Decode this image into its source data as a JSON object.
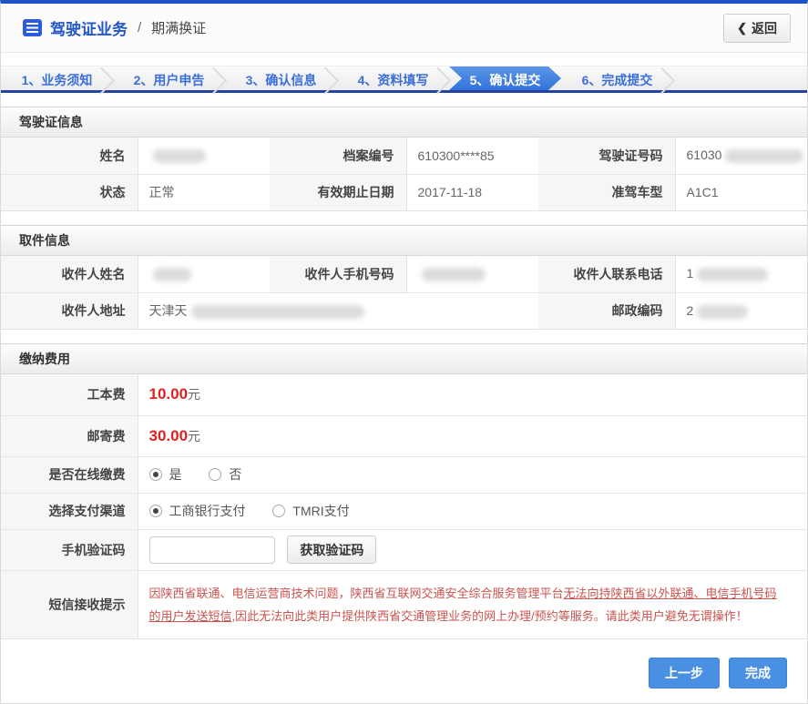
{
  "header": {
    "breadcrumb_section": "驾驶证业务",
    "breadcrumb_separator": "/",
    "breadcrumb_current": "期满换证",
    "back_chevron": "❮",
    "back_label": "返回"
  },
  "steps": [
    {
      "label": "1、业务须知",
      "active": false
    },
    {
      "label": "2、用户申告",
      "active": false
    },
    {
      "label": "3、确认信息",
      "active": false
    },
    {
      "label": "4、资料填写",
      "active": false
    },
    {
      "label": "5、确认提交",
      "active": true
    },
    {
      "label": "6、完成提交",
      "active": false
    }
  ],
  "license_section": {
    "title": "驾驶证信息",
    "fields": [
      {
        "label": "姓名",
        "value": "",
        "redacted": true
      },
      {
        "label": "档案编号",
        "value": "610300****85",
        "redacted": false
      },
      {
        "label": "驾驶证号码",
        "value": "61030",
        "redacted": true
      },
      {
        "label": "状态",
        "value": "正常",
        "redacted": false
      },
      {
        "label": "有效期止日期",
        "value": "2017-11-18",
        "redacted": false
      },
      {
        "label": "准驾车型",
        "value": "A1C1",
        "redacted": false
      }
    ]
  },
  "pickup_section": {
    "title": "取件信息",
    "fields": [
      {
        "label": "收件人姓名",
        "value": "",
        "redacted": true
      },
      {
        "label": "收件人手机号码",
        "value": "",
        "redacted": true
      },
      {
        "label": "收件人联系电话",
        "value": "1",
        "redacted": true
      },
      {
        "label": "收件人地址",
        "value": "天津天",
        "redacted": true
      },
      {
        "label": "邮政编码",
        "value": "2",
        "redacted": true
      }
    ]
  },
  "payment_section": {
    "title": "缴纳费用",
    "fees": [
      {
        "label": "工本费",
        "amount": "10.00",
        "unit": "元"
      },
      {
        "label": "邮寄费",
        "amount": "30.00",
        "unit": "元"
      }
    ],
    "online_payment": {
      "label": "是否在线缴费",
      "options": [
        {
          "label": "是",
          "selected": true
        },
        {
          "label": "否",
          "selected": false
        }
      ]
    },
    "channel": {
      "label": "选择支付渠道",
      "options": [
        {
          "label": "工商银行支付",
          "selected": true
        },
        {
          "label": "TMRI支付",
          "selected": false
        }
      ]
    },
    "sms_code": {
      "label": "手机验证码",
      "input_value": "",
      "button_label": "获取验证码"
    },
    "notice": {
      "label": "短信接收提示",
      "text_before": "因陕西省联通、电信运营商技术问题，陕西省互联网交通安全综合服务管理平台",
      "text_underlined": "无法向持陕西省以外联通、电信手机号码的用户发送短信",
      "text_after": ",因此无法向此类用户提供陕西省交通管理业务的网上办理/预约等服务。请此类用户避免无谓操作！"
    }
  },
  "footer": {
    "prev_label": "上一步",
    "finish_label": "完成"
  },
  "colors": {
    "accent_blue": "#1a53c4",
    "link_blue": "#3a6fd9",
    "active_step_blue": "#3272d9",
    "step_underline_navy": "#2643a0",
    "fee_red": "#e01f1f",
    "notice_red": "#c9534e",
    "button_blue": "#4a90e2"
  }
}
